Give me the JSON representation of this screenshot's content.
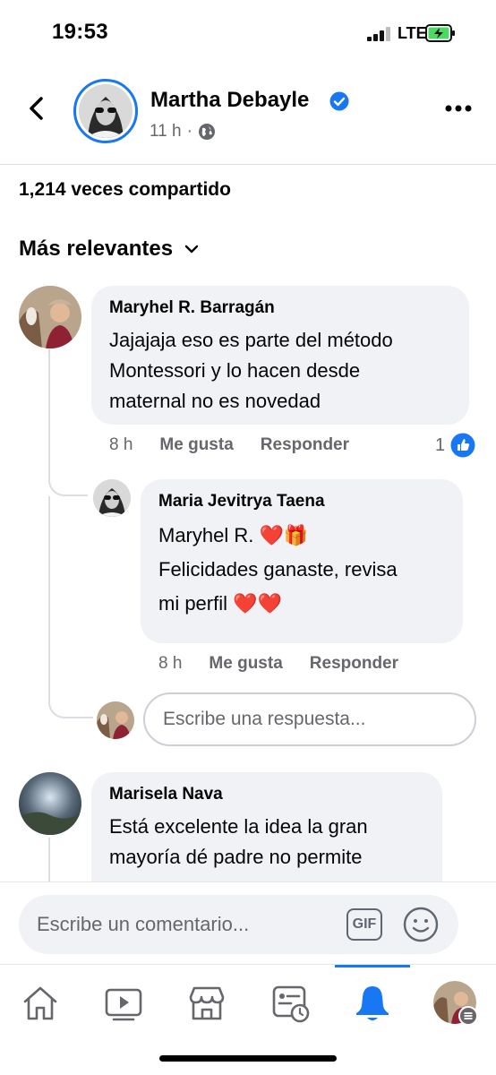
{
  "status_bar": {
    "time": "19:53",
    "network": "LTE"
  },
  "header": {
    "author": "Martha Debayle",
    "post_time": "11 h",
    "post_time_separator": "·"
  },
  "shares_label": "1,214 veces compartido",
  "sort_label": "Más relevantes",
  "comments": [
    {
      "author": "Maryhel R. Barragán",
      "lines": [
        "Jajajaja eso es parte del método",
        "Montessori y lo hacen desde",
        "maternal no es novedad"
      ],
      "time": "8 h",
      "like_label": "Me gusta",
      "reply_label": "Responder",
      "reaction_count": "1"
    },
    {
      "author": "Maria Jevitrya Taena",
      "lines": [
        "Maryhel R.  ❤️🎁",
        "Felicidades ganaste, revisa",
        "mi perfil ❤️❤️"
      ],
      "time": "8 h",
      "like_label": "Me gusta",
      "reply_label": "Responder"
    },
    {
      "author": "Marisela Nava",
      "lines": [
        "Está excelente la idea la gran",
        "mayoría dé padre no permite"
      ]
    }
  ],
  "reply_placeholder": "Escribe una respuesta...",
  "composer": {
    "placeholder": "Escribe un comentario...",
    "gif_label": "GIF"
  },
  "colors": {
    "accent": "#1877f2",
    "bubble": "#f0f2f5",
    "muted": "#65676b"
  },
  "tabs": [
    "home-icon",
    "video-icon",
    "marketplace-icon",
    "news-icon",
    "notifications-icon",
    "profile-menu-icon"
  ],
  "active_tab": "notifications-icon"
}
